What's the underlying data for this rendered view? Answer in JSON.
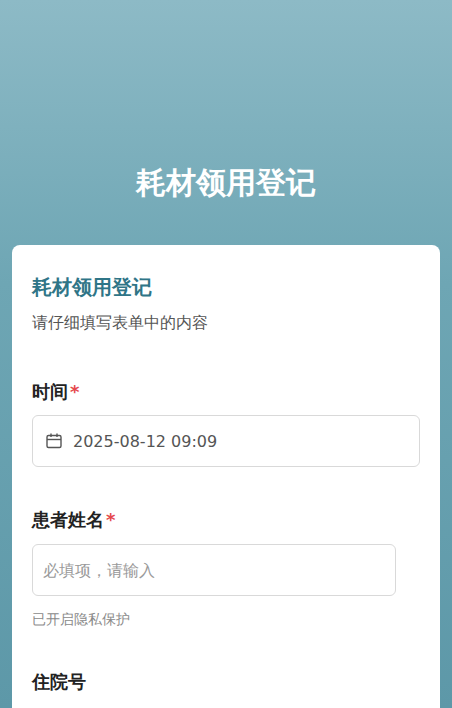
{
  "header": {
    "title": "耗材领用登记"
  },
  "form": {
    "title": "耗材领用登记",
    "description": "请仔细填写表单中的内容",
    "required_mark": "*",
    "fields": [
      {
        "label": "时间",
        "required": true,
        "kind": "datetime",
        "value": "2025-08-12 09:09",
        "placeholder": "",
        "hint": ""
      },
      {
        "label": "患者姓名",
        "required": true,
        "kind": "text",
        "value": "",
        "placeholder": "必填项，请输入",
        "hint": "已开启隐私保护"
      },
      {
        "label": "住院号",
        "required": false,
        "kind": "label-only",
        "value": "",
        "placeholder": "",
        "hint": ""
      }
    ]
  }
}
